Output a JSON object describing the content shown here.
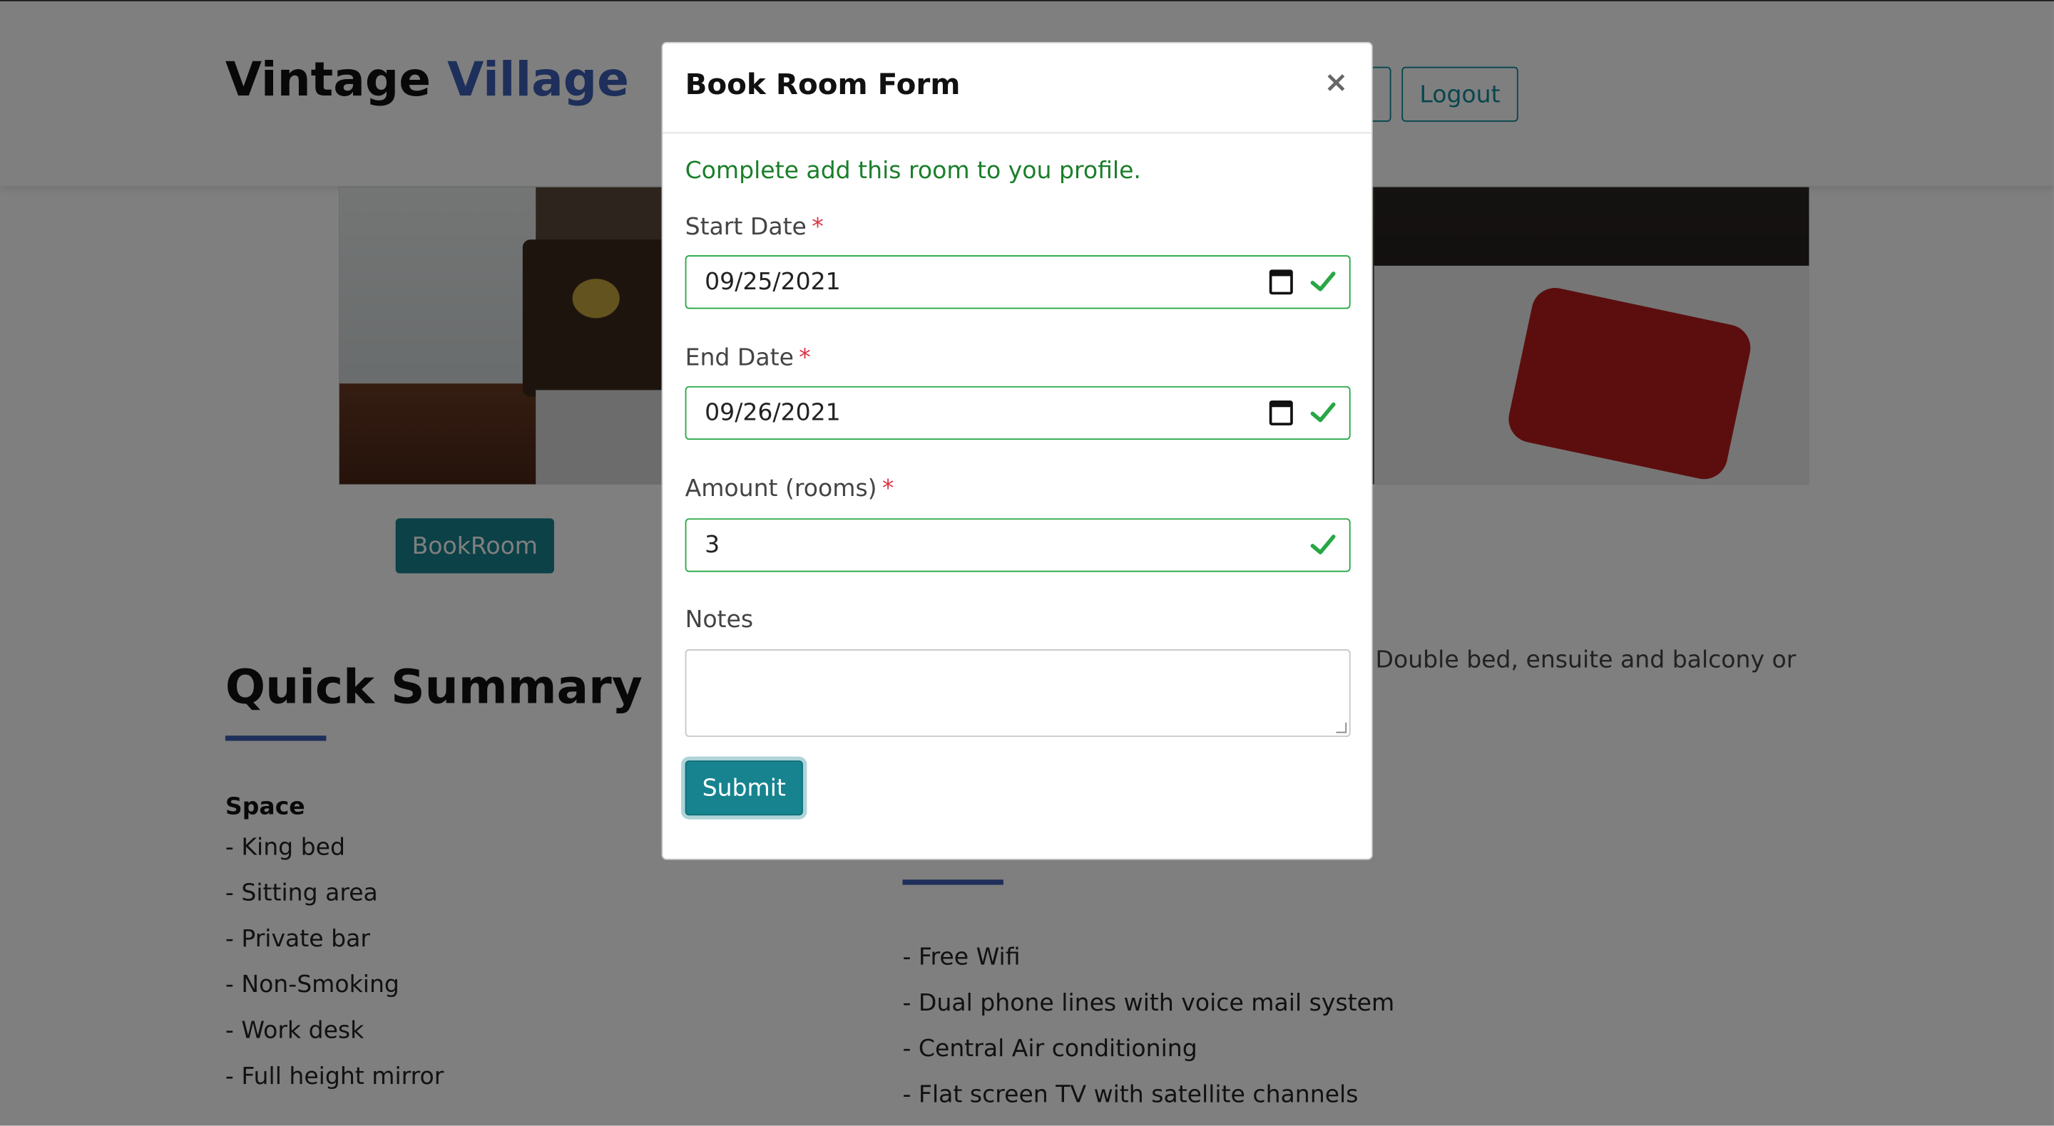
{
  "header": {
    "brand_main": "Vintage",
    "brand_accent": "Village",
    "logout_label": "Logout"
  },
  "main": {
    "book_button_label": "BookRoom",
    "summary_title": "Quick Summary",
    "space_title": "Space",
    "space_items": [
      "- King bed",
      "- Sitting area",
      "- Private bar",
      "- Non-Smoking",
      "- Work desk",
      "- Full height mirror"
    ],
    "description_fragment": "Double bed, ensuite and balcony or",
    "amenity_items": [
      "- Free Wifi",
      "- Dual phone lines with voice mail system",
      "- Central Air conditioning",
      "- Flat screen TV with satellite channels"
    ]
  },
  "modal": {
    "title": "Book Room Form",
    "close_symbol": "×",
    "message": "Complete add this room to you profile.",
    "start_date_label": "Start Date",
    "start_date_value": "09/25/2021",
    "end_date_label": "End Date",
    "end_date_value": "09/26/2021",
    "amount_label": "Amount (rooms)",
    "amount_value": "3",
    "notes_label": "Notes",
    "notes_value": "",
    "required_marker": "*",
    "submit_label": "Submit"
  },
  "colors": {
    "accent_blue": "#3d5fb6",
    "teal": "#16838f",
    "valid_green": "#28a745",
    "required_red": "#dc3545"
  }
}
